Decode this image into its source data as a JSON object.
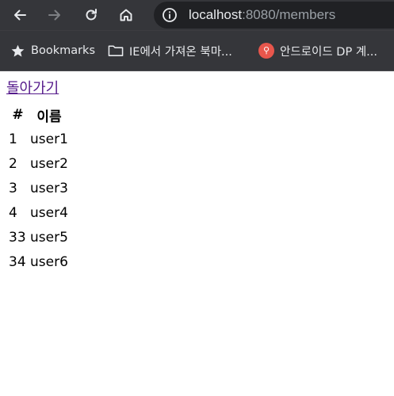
{
  "browser": {
    "url_host": "localhost",
    "url_rest": ":8080/members",
    "bookmarks": [
      {
        "label": "Bookmarks",
        "icon": "star-icon"
      },
      {
        "label": "IE에서 가져온 북마...",
        "icon": "folder-icon"
      },
      {
        "label": "안드로이드 DP 계...",
        "icon": "android-dp-icon"
      }
    ]
  },
  "page": {
    "back_link": "돌아가기",
    "table": {
      "headers": [
        "#",
        "이름"
      ],
      "rows": [
        {
          "id": "1",
          "name": "user1"
        },
        {
          "id": "2",
          "name": "user2"
        },
        {
          "id": "3",
          "name": "user3"
        },
        {
          "id": "4",
          "name": "user4"
        },
        {
          "id": "33",
          "name": "user5"
        },
        {
          "id": "34",
          "name": "user6"
        }
      ]
    }
  },
  "colors": {
    "chrome_bg": "#35363a",
    "omnibox_bg": "#202124",
    "visited_link": "#551a8b"
  }
}
